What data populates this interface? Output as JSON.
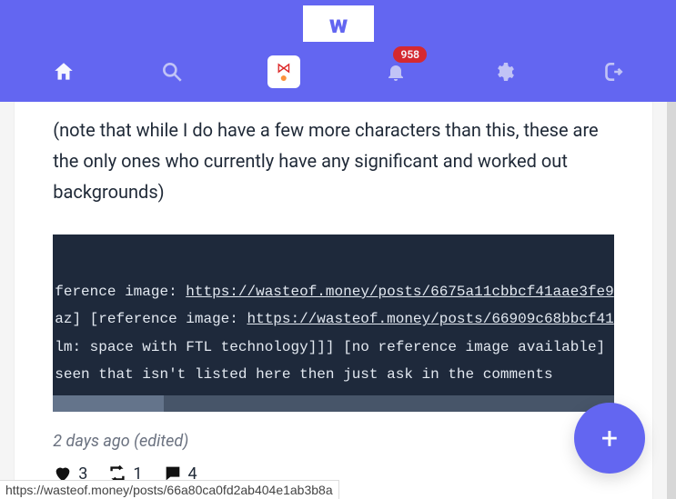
{
  "header": {
    "logo": "w",
    "notif_count": "958"
  },
  "post": {
    "note": "(note that while I do have a few more characters than this, these are the only ones who currently have any significant and worked out backgrounds)",
    "code": {
      "l1_pre": "ference image: ",
      "l1_link": "https://wasteof.money/posts/6675a11cbbcf41aae3fe9",
      "l2_pre": "az] [reference image: ",
      "l2_link": "https://wasteof.money/posts/66909c68bbcf41",
      "l3": "lm: space with FTL technology]]] [no reference image available]",
      "l4": " seen that isn't listed here then just ask in the comments"
    },
    "timestamp": "2 days ago (edited)",
    "actions": {
      "loves": "3",
      "reposts": "1",
      "comments": "4"
    }
  },
  "fab": {
    "label": "+"
  },
  "status_url": "https://wasteof.money/posts/66a80ca0fd2ab404e1ab3b8a"
}
